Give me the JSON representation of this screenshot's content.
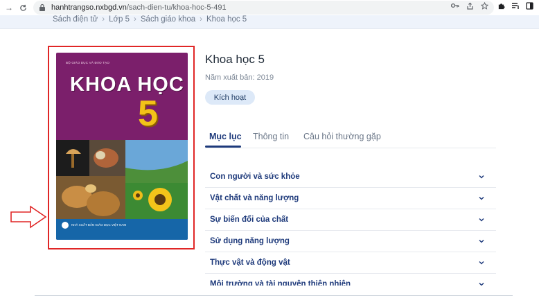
{
  "browser": {
    "url_host": "hanhtrangso.nxbgd.vn",
    "url_path": "/sach-dien-tu/khoa-hoc-5-491"
  },
  "breadcrumb": {
    "items": [
      "Sách điện tử",
      "Lớp 5",
      "Sách giáo khoa",
      "Khoa học 5"
    ],
    "separator": "›"
  },
  "cover": {
    "publisher_top": "BỘ GIÁO DỤC VÀ ĐÀO TẠO",
    "title": "KHOA HỌC",
    "grade": "5",
    "publisher_bottom": "NHÀ XUẤT BẢN GIÁO DỤC VIỆT NAM",
    "background_color": "#7b1f6b",
    "highlight_color": "#e02626"
  },
  "book": {
    "title": "Khoa học 5",
    "publish_year": "Năm xuất bản: 2019",
    "activate_label": "Kích hoạt"
  },
  "tabs": [
    {
      "label": "Mục lục",
      "active": true
    },
    {
      "label": "Thông tin",
      "active": false
    },
    {
      "label": "Câu hỏi thường gặp",
      "active": false
    }
  ],
  "toc": [
    "Con người và sức khỏe",
    "Vật chất và năng lượng",
    "Sự biến đổi của chất",
    "Sử dụng năng lượng",
    "Thực vật và động vật",
    "Môi trường và tài nguyên thiên nhiên"
  ],
  "colors": {
    "accent": "#1e3a7b",
    "activate_bg": "#dde9f8",
    "crumb_bg": "#eef3fb",
    "arrow": "#e02626"
  }
}
